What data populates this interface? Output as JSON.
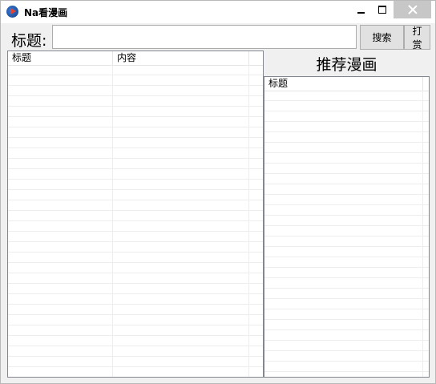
{
  "window": {
    "title": "Na看漫画"
  },
  "search": {
    "label": "标题:",
    "value": "",
    "placeholder": ""
  },
  "buttons": {
    "search": "搜索",
    "donate": "打赏"
  },
  "results": {
    "columns": [
      "标题",
      "内容"
    ]
  },
  "recommend": {
    "title": "推荐漫画",
    "columns": [
      "标题"
    ]
  },
  "colors": {
    "close_button": "#c7c7c7",
    "list_border": "#828790",
    "window_bg": "#f0f0f0"
  }
}
